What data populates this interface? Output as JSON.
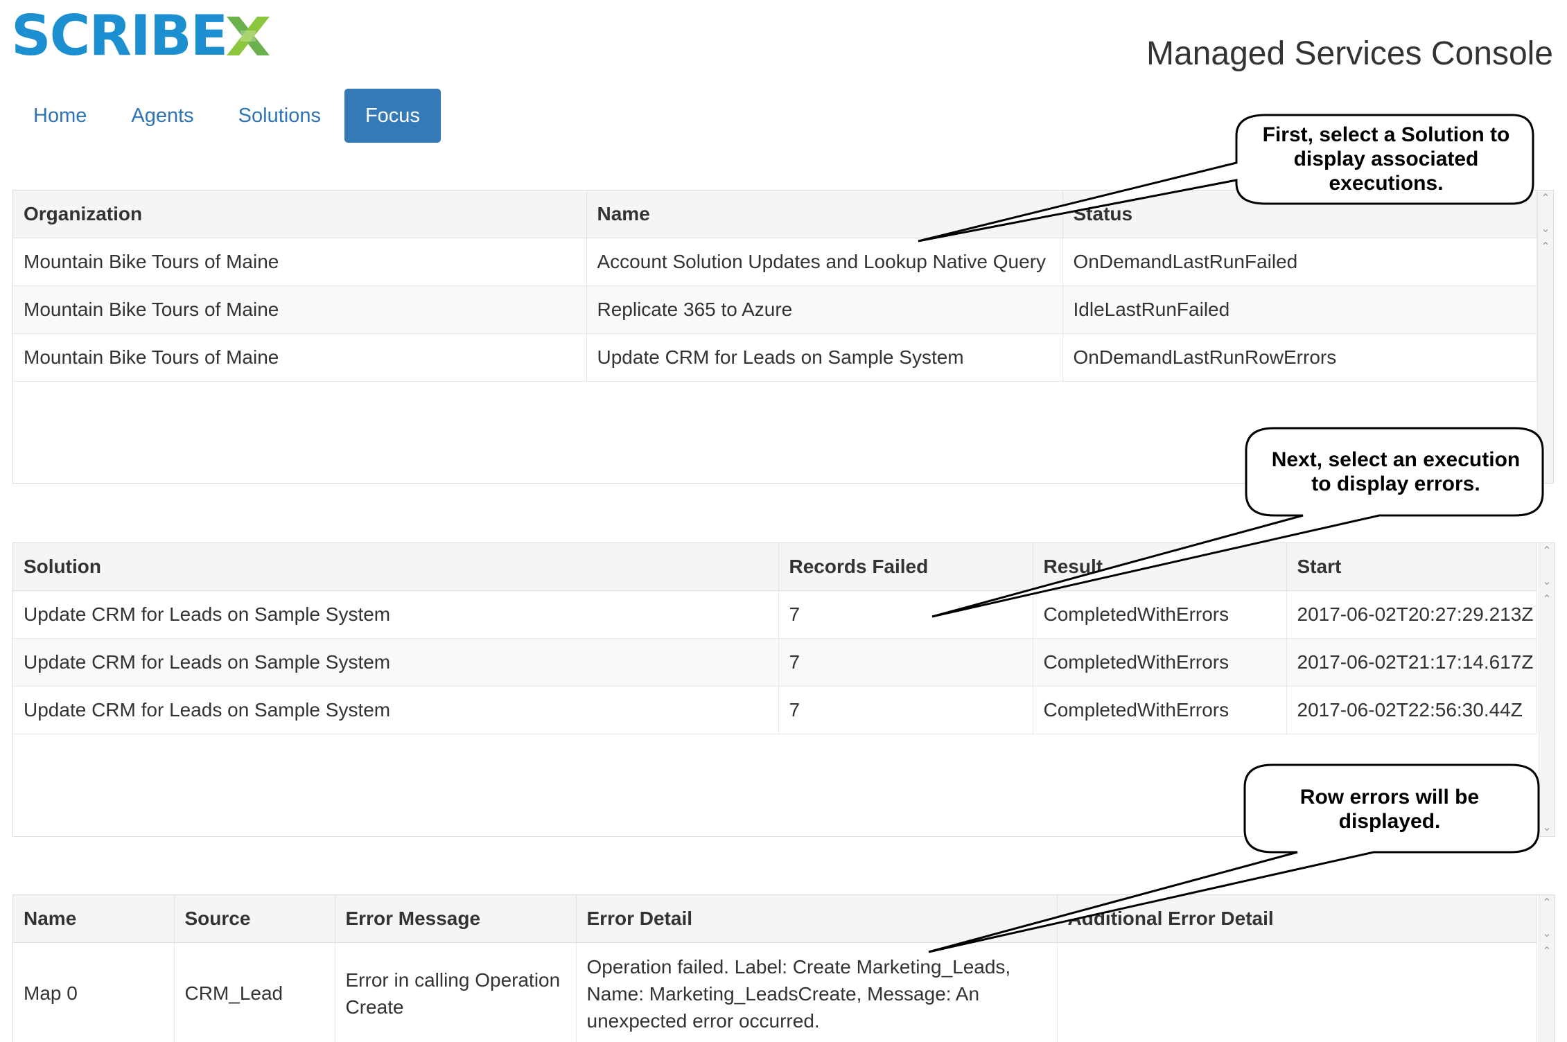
{
  "brand": {
    "logo_text": "SCRIBE",
    "logo_mark": "x-mark-icon",
    "brand_color": "#1b8fd0",
    "mark_color": "#6ab04c"
  },
  "header": {
    "title": "Managed Services Console"
  },
  "nav": {
    "items": [
      {
        "label": "Home",
        "active": false
      },
      {
        "label": "Agents",
        "active": false
      },
      {
        "label": "Solutions",
        "active": false
      },
      {
        "label": "Focus",
        "active": true
      }
    ],
    "active_color": "#337ab7"
  },
  "solutions_grid": {
    "columns": [
      "Organization",
      "Name",
      "Status"
    ],
    "rows": [
      [
        "Mountain Bike Tours of Maine",
        "Account Solution Updates and Lookup Native Query",
        "OnDemandLastRunFailed"
      ],
      [
        "Mountain Bike Tours of Maine",
        "Replicate 365 to Azure",
        "IdleLastRunFailed"
      ],
      [
        "Mountain Bike Tours of Maine",
        "Update CRM for Leads on Sample System",
        "OnDemandLastRunRowErrors"
      ]
    ]
  },
  "executions_grid": {
    "columns": [
      "Solution",
      "Records Failed",
      "Result",
      "Start"
    ],
    "rows": [
      [
        "Update CRM for Leads on Sample System",
        "7",
        "CompletedWithErrors",
        "2017-06-02T20:27:29.213Z"
      ],
      [
        "Update CRM for Leads on Sample System",
        "7",
        "CompletedWithErrors",
        "2017-06-02T21:17:14.617Z"
      ],
      [
        "Update CRM for Leads on Sample System",
        "7",
        "CompletedWithErrors",
        "2017-06-02T22:56:30.44Z"
      ]
    ]
  },
  "errors_grid": {
    "columns": [
      "Name",
      "Source",
      "Error Message",
      "Error Detail",
      "Additional Error Detail"
    ],
    "rows": [
      [
        "Map 0",
        "CRM_Lead",
        "Error in calling Operation Create",
        "Operation failed. Label: Create Marketing_Leads, Name: Marketing_LeadsCreate, Message: An unexpected error occurred.",
        ""
      ]
    ]
  },
  "callouts": [
    {
      "text": "First, select a Solution to display associated executions."
    },
    {
      "text": "Next, select an execution to display errors."
    },
    {
      "text": "Row errors will be displayed."
    }
  ]
}
